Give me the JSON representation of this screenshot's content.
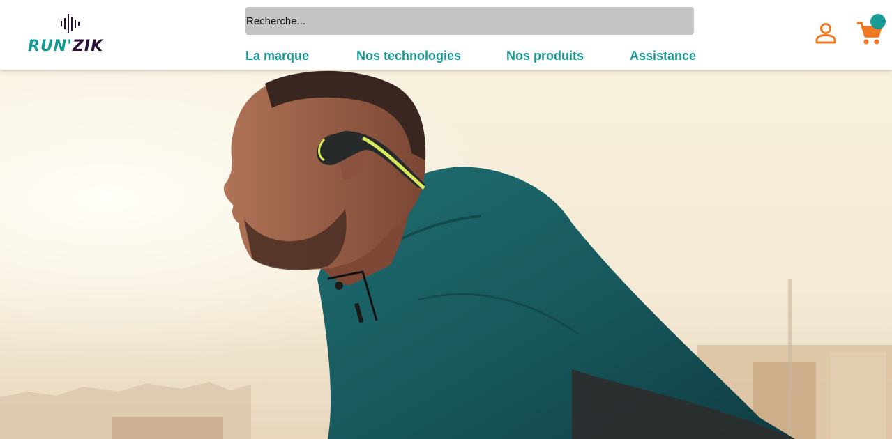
{
  "brand": {
    "name_part1": "RUN'",
    "name_part2": "ZIK",
    "icon": "sound-wave-icon",
    "colors": {
      "primary": "#149a94",
      "secondary": "#2a0f3a"
    }
  },
  "search": {
    "placeholder": "Recherche...",
    "value": ""
  },
  "nav": {
    "items": [
      {
        "label": "La marque"
      },
      {
        "label": "Nos technologies"
      },
      {
        "label": "Nos produits"
      },
      {
        "label": "Assistance"
      }
    ],
    "color": "#1b9896"
  },
  "header_icons": {
    "account_icon": "user-account-icon",
    "cart_icon": "shopping-cart-icon",
    "cart_badge": "",
    "icon_color": "#f07822",
    "badge_color": "#1a9a94"
  },
  "hero": {
    "image": "runner-with-bone-conduction-headphones"
  }
}
